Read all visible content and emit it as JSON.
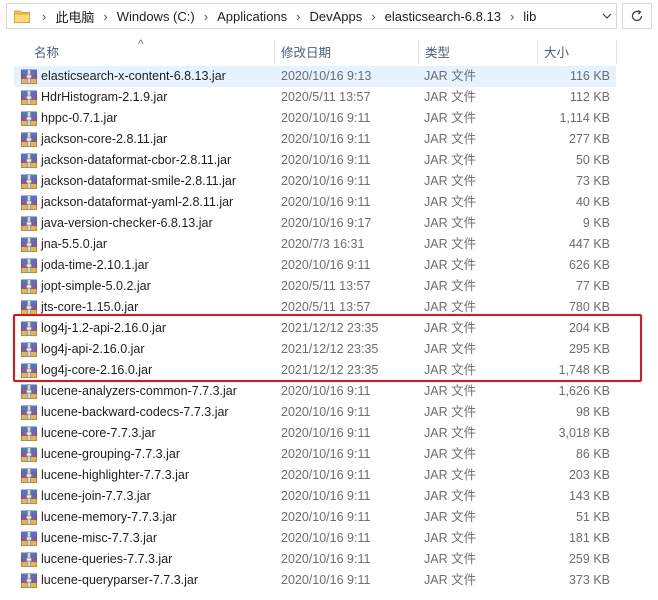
{
  "address": {
    "crumbs": [
      "此电脑",
      "Windows (C:)",
      "Applications",
      "DevApps",
      "elasticsearch-6.8.13",
      "lib"
    ]
  },
  "columns": {
    "name": "名称",
    "date": "修改日期",
    "type": "类型",
    "size": "大小"
  },
  "files": [
    {
      "name": "elasticsearch-x-content-6.8.13.jar",
      "date": "2020/10/16 9:13",
      "type": "JAR 文件",
      "size": "116 KB",
      "selected": true
    },
    {
      "name": "HdrHistogram-2.1.9.jar",
      "date": "2020/5/11 13:57",
      "type": "JAR 文件",
      "size": "112 KB"
    },
    {
      "name": "hppc-0.7.1.jar",
      "date": "2020/10/16 9:11",
      "type": "JAR 文件",
      "size": "1,114 KB"
    },
    {
      "name": "jackson-core-2.8.11.jar",
      "date": "2020/10/16 9:11",
      "type": "JAR 文件",
      "size": "277 KB"
    },
    {
      "name": "jackson-dataformat-cbor-2.8.11.jar",
      "date": "2020/10/16 9:11",
      "type": "JAR 文件",
      "size": "50 KB"
    },
    {
      "name": "jackson-dataformat-smile-2.8.11.jar",
      "date": "2020/10/16 9:11",
      "type": "JAR 文件",
      "size": "73 KB"
    },
    {
      "name": "jackson-dataformat-yaml-2.8.11.jar",
      "date": "2020/10/16 9:11",
      "type": "JAR 文件",
      "size": "40 KB"
    },
    {
      "name": "java-version-checker-6.8.13.jar",
      "date": "2020/10/16 9:17",
      "type": "JAR 文件",
      "size": "9 KB"
    },
    {
      "name": "jna-5.5.0.jar",
      "date": "2020/7/3 16:31",
      "type": "JAR 文件",
      "size": "447 KB"
    },
    {
      "name": "joda-time-2.10.1.jar",
      "date": "2020/10/16 9:11",
      "type": "JAR 文件",
      "size": "626 KB"
    },
    {
      "name": "jopt-simple-5.0.2.jar",
      "date": "2020/5/11 13:57",
      "type": "JAR 文件",
      "size": "77 KB"
    },
    {
      "name": "jts-core-1.15.0.jar",
      "date": "2020/5/11 13:57",
      "type": "JAR 文件",
      "size": "780 KB"
    },
    {
      "name": "log4j-1.2-api-2.16.0.jar",
      "date": "2021/12/12 23:35",
      "type": "JAR 文件",
      "size": "204 KB"
    },
    {
      "name": "log4j-api-2.16.0.jar",
      "date": "2021/12/12 23:35",
      "type": "JAR 文件",
      "size": "295 KB"
    },
    {
      "name": "log4j-core-2.16.0.jar",
      "date": "2021/12/12 23:35",
      "type": "JAR 文件",
      "size": "1,748 KB"
    },
    {
      "name": "lucene-analyzers-common-7.7.3.jar",
      "date": "2020/10/16 9:11",
      "type": "JAR 文件",
      "size": "1,626 KB"
    },
    {
      "name": "lucene-backward-codecs-7.7.3.jar",
      "date": "2020/10/16 9:11",
      "type": "JAR 文件",
      "size": "98 KB"
    },
    {
      "name": "lucene-core-7.7.3.jar",
      "date": "2020/10/16 9:11",
      "type": "JAR 文件",
      "size": "3,018 KB"
    },
    {
      "name": "lucene-grouping-7.7.3.jar",
      "date": "2020/10/16 9:11",
      "type": "JAR 文件",
      "size": "86 KB"
    },
    {
      "name": "lucene-highlighter-7.7.3.jar",
      "date": "2020/10/16 9:11",
      "type": "JAR 文件",
      "size": "203 KB"
    },
    {
      "name": "lucene-join-7.7.3.jar",
      "date": "2020/10/16 9:11",
      "type": "JAR 文件",
      "size": "143 KB"
    },
    {
      "name": "lucene-memory-7.7.3.jar",
      "date": "2020/10/16 9:11",
      "type": "JAR 文件",
      "size": "51 KB"
    },
    {
      "name": "lucene-misc-7.7.3.jar",
      "date": "2020/10/16 9:11",
      "type": "JAR 文件",
      "size": "181 KB"
    },
    {
      "name": "lucene-queries-7.7.3.jar",
      "date": "2020/10/16 9:11",
      "type": "JAR 文件",
      "size": "259 KB"
    },
    {
      "name": "lucene-queryparser-7.7.3.jar",
      "date": "2020/10/16 9:11",
      "type": "JAR 文件",
      "size": "373 KB"
    }
  ],
  "colors": {
    "selection": "#e5f3ff",
    "highlight_border": "#e8101b",
    "header_text": "#4c607a"
  },
  "icons": {
    "address": "folder-icon",
    "file": "jar-icon",
    "refresh": "refresh-icon"
  }
}
